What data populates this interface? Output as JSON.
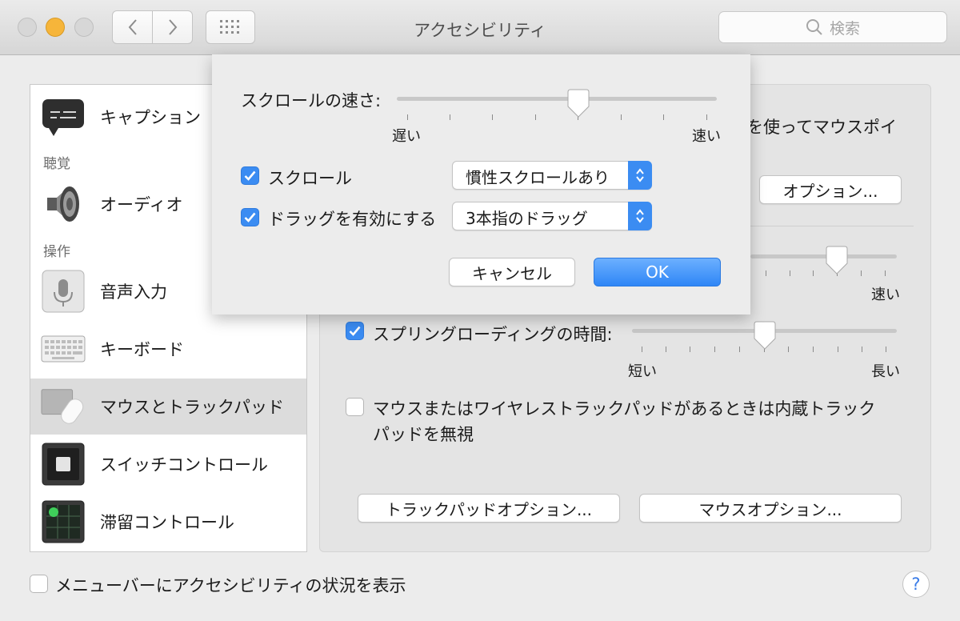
{
  "window": {
    "title": "アクセシビリティ"
  },
  "search": {
    "placeholder": "検索"
  },
  "sidebar": {
    "items": [
      {
        "label": "キャプション",
        "icon": "caption-icon"
      },
      {
        "label": "オーディオ",
        "icon": "speaker-icon"
      },
      {
        "label": "音声入力",
        "icon": "microphone-icon"
      },
      {
        "label": "キーボード",
        "icon": "keyboard-icon"
      },
      {
        "label": "マウスとトラックパッド",
        "icon": "mouse-trackpad-icon",
        "selected": true
      },
      {
        "label": "スイッチコントロール",
        "icon": "switch-control-icon"
      },
      {
        "label": "滞留コントロール",
        "icon": "dwell-control-icon"
      }
    ],
    "sections": {
      "hearing": "聴覚",
      "interaction": "操作"
    }
  },
  "panel": {
    "partial_text": "を使ってマウスポイ",
    "options_button": "オプション...",
    "speed_fast": "速い",
    "speed_fast_value": 0.78,
    "spring_loading_label": "スプリングローディングの時間:",
    "spring_loading_checked": true,
    "spring_loading_value": 0.5,
    "spring_short": "短い",
    "spring_long": "長い",
    "ignore_trackpad_label_line1": "マウスまたはワイヤレストラックパッドがあるときは内蔵トラック",
    "ignore_trackpad_label_line2": "パッドを無視",
    "ignore_trackpad_checked": false,
    "trackpad_options_button": "トラックパッドオプション...",
    "mouse_options_button": "マウスオプション..."
  },
  "sheet": {
    "scroll_speed_label": "スクロールの速さ:",
    "scroll_speed_value": 0.55,
    "slow_label": "遅い",
    "fast_label": "速い",
    "scroll_label": "スクロール",
    "scroll_checked": true,
    "scroll_mode_value": "慣性スクロールあり",
    "drag_label": "ドラッグを有効にする",
    "drag_checked": true,
    "drag_mode_value": "3本指のドラッグ",
    "cancel_button": "キャンセル",
    "ok_button": "OK"
  },
  "footer": {
    "menubar_status_label": "メニューバーにアクセシビリティの状況を表示",
    "menubar_status_checked": false
  },
  "colors": {
    "accent": "#3b8cf2",
    "minimize": "#f6b53a"
  }
}
